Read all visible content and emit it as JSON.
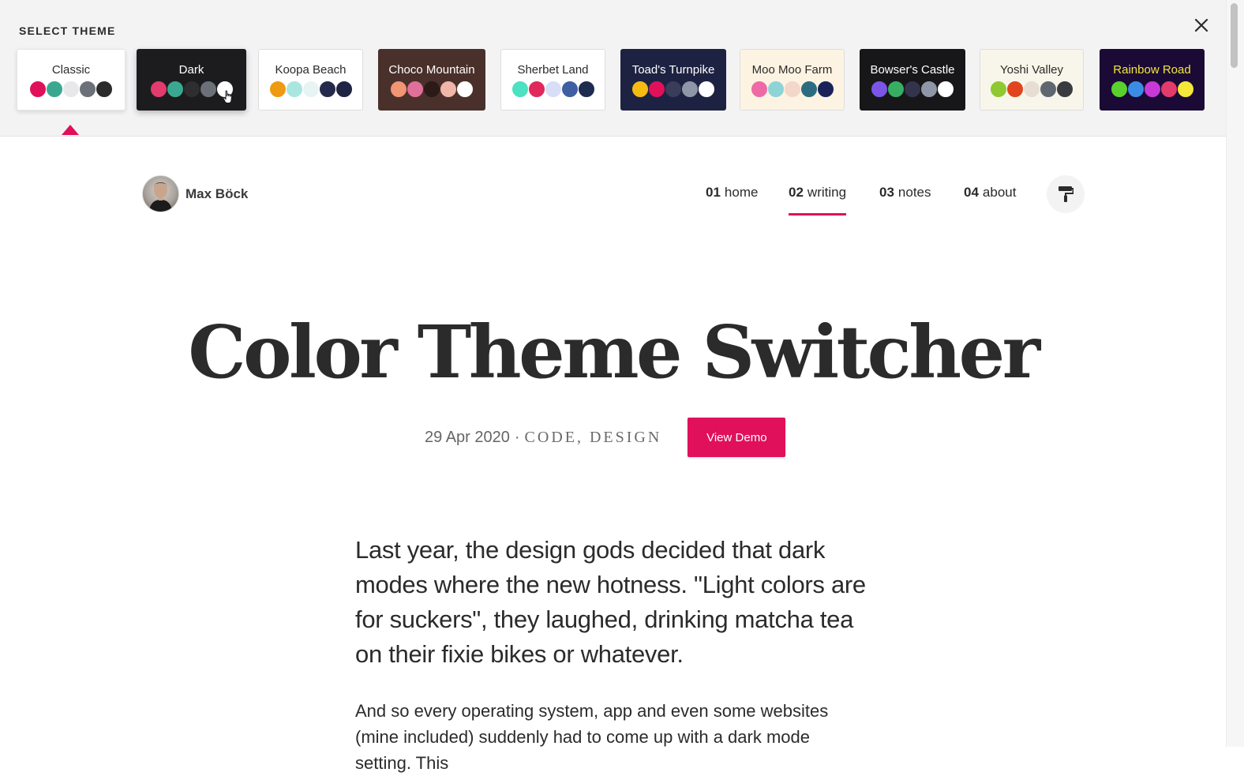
{
  "panel": {
    "title": "SELECT THEME",
    "close_icon": "close-icon",
    "themes": [
      {
        "name": "Classic",
        "bg": "#ffffff",
        "text": "#2b2b2b",
        "swatches": [
          "#e0105b",
          "#3aa890",
          "#e8e8ea",
          "#6b7079",
          "#2b2b2b"
        ]
      },
      {
        "name": "Dark",
        "bg": "#1c1c1e",
        "text": "#ffffff",
        "swatches": [
          "#e23b6e",
          "#3aa890",
          "#2e2e31",
          "#6b7079",
          "#ffffff"
        ]
      },
      {
        "name": "Koopa Beach",
        "bg": "#ffffff",
        "text": "#2b2b2b",
        "swatches": [
          "#ee9a12",
          "#a9e6e0",
          "#e8f4f4",
          "#262a4a",
          "#1f2344"
        ]
      },
      {
        "name": "Choco Mountain",
        "bg": "#4a302a",
        "text": "#ffffff",
        "swatches": [
          "#f19575",
          "#e06f9a",
          "#2b1a17",
          "#f0b6a8",
          "#ffffff"
        ]
      },
      {
        "name": "Sherbet Land",
        "bg": "#ffffff",
        "text": "#2b2b2b",
        "swatches": [
          "#4ae2c0",
          "#e0285b",
          "#d7def6",
          "#3f5fa3",
          "#1c2b4f"
        ]
      },
      {
        "name": "Toad's Turnpike",
        "bg": "#1e2242",
        "text": "#ffffff",
        "swatches": [
          "#f5bb12",
          "#e0105b",
          "#3a3d5a",
          "#8e96a7",
          "#ffffff"
        ]
      },
      {
        "name": "Moo Moo Farm",
        "bg": "#fdf3e2",
        "text": "#2b2b2b",
        "swatches": [
          "#ee6aa7",
          "#8ed3d6",
          "#f3d7c8",
          "#2d6c80",
          "#1b2159"
        ]
      },
      {
        "name": "Bowser's Castle",
        "bg": "#17171a",
        "text": "#ffffff",
        "swatches": [
          "#7a55e8",
          "#38ae63",
          "#33334e",
          "#8e96a7",
          "#ffffff"
        ]
      },
      {
        "name": "Yoshi Valley",
        "bg": "#f8f6ea",
        "text": "#2b2b2b",
        "swatches": [
          "#8fc932",
          "#e1441e",
          "#e6ddd3",
          "#5f6770",
          "#393b41"
        ]
      },
      {
        "name": "Rainbow Road",
        "bg": "#1a0a35",
        "text": "#f3e83a",
        "swatches": [
          "#5ad02f",
          "#3b8de3",
          "#c73ad8",
          "#e33b6b",
          "#f3e83a"
        ]
      }
    ]
  },
  "header": {
    "brand_name": "Max Böck",
    "nav": [
      {
        "num": "01",
        "label": "home"
      },
      {
        "num": "02",
        "label": "writing"
      },
      {
        "num": "03",
        "label": "notes"
      },
      {
        "num": "04",
        "label": "about"
      }
    ],
    "toggle_icon": "paint-roller-icon"
  },
  "article": {
    "title": "Color Theme Switcher",
    "date": "29 Apr 2020",
    "separator": "·",
    "tags": "CODE, DESIGN",
    "demo_button": "View Demo",
    "lead": "Last year, the design gods decided that dark modes where the new hotness. \"Light colors are for suckers\", they laughed, drinking matcha tea on their fixie bikes or whatever.",
    "body": "And so every operating system, app and even some websites (mine included) suddenly had to come up with a dark mode setting. This"
  },
  "colors": {
    "accent": "#e0105b",
    "panel_bg": "#f3f3f4"
  }
}
